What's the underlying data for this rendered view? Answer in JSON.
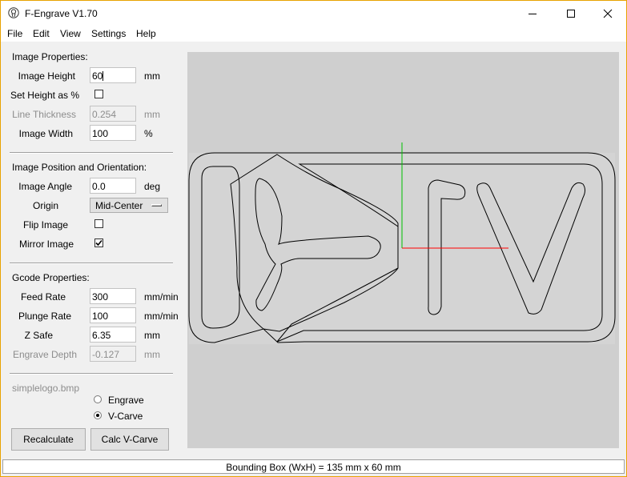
{
  "window": {
    "title": "F-Engrave V1.70"
  },
  "menu": [
    "File",
    "Edit",
    "View",
    "Settings",
    "Help"
  ],
  "image_properties": {
    "heading": "Image Properties:",
    "image_height": {
      "label": "Image Height",
      "value": "60",
      "unit": "mm"
    },
    "set_height_pct": {
      "label": "Set Height as %",
      "checked": false
    },
    "line_thickness": {
      "label": "Line Thickness",
      "value": "0.254",
      "unit": "mm"
    },
    "image_width": {
      "label": "Image Width",
      "value": "100",
      "unit": "%"
    }
  },
  "position": {
    "heading": "Image Position and Orientation:",
    "image_angle": {
      "label": "Image Angle",
      "value": "0.0",
      "unit": "deg"
    },
    "origin": {
      "label": "Origin",
      "value": "Mid-Center"
    },
    "flip_image": {
      "label": "Flip Image",
      "checked": false
    },
    "mirror_image": {
      "label": "Mirror Image",
      "checked": true
    }
  },
  "gcode": {
    "heading": "Gcode Properties:",
    "feed_rate": {
      "label": "Feed Rate",
      "value": "300",
      "unit": "mm/min"
    },
    "plunge_rate": {
      "label": "Plunge Rate",
      "value": "100",
      "unit": "mm/min"
    },
    "z_safe": {
      "label": "Z Safe",
      "value": "6.35",
      "unit": "mm"
    },
    "engrave_depth": {
      "label": "Engrave Depth",
      "value": "-0.127",
      "unit": "mm"
    }
  },
  "file": {
    "name": "simplelogo.bmp"
  },
  "mode": {
    "options": [
      "Engrave",
      "V-Carve"
    ],
    "selected": "V-Carve"
  },
  "buttons": {
    "recalculate": "Recalculate",
    "calc_vcarve": "Calc V-Carve"
  },
  "status": {
    "text": "Bounding Box (WxH) = 135 mm  x 60 mm"
  },
  "colors": {
    "x_axis": "#ff0000",
    "y_axis": "#00c000",
    "canvas_bg": "#cfcfcf",
    "drawing_bg": "#d4d4d4"
  },
  "icons": [
    "app-icon",
    "minimize-icon",
    "maximize-icon",
    "close-icon",
    "checkmark-icon"
  ]
}
